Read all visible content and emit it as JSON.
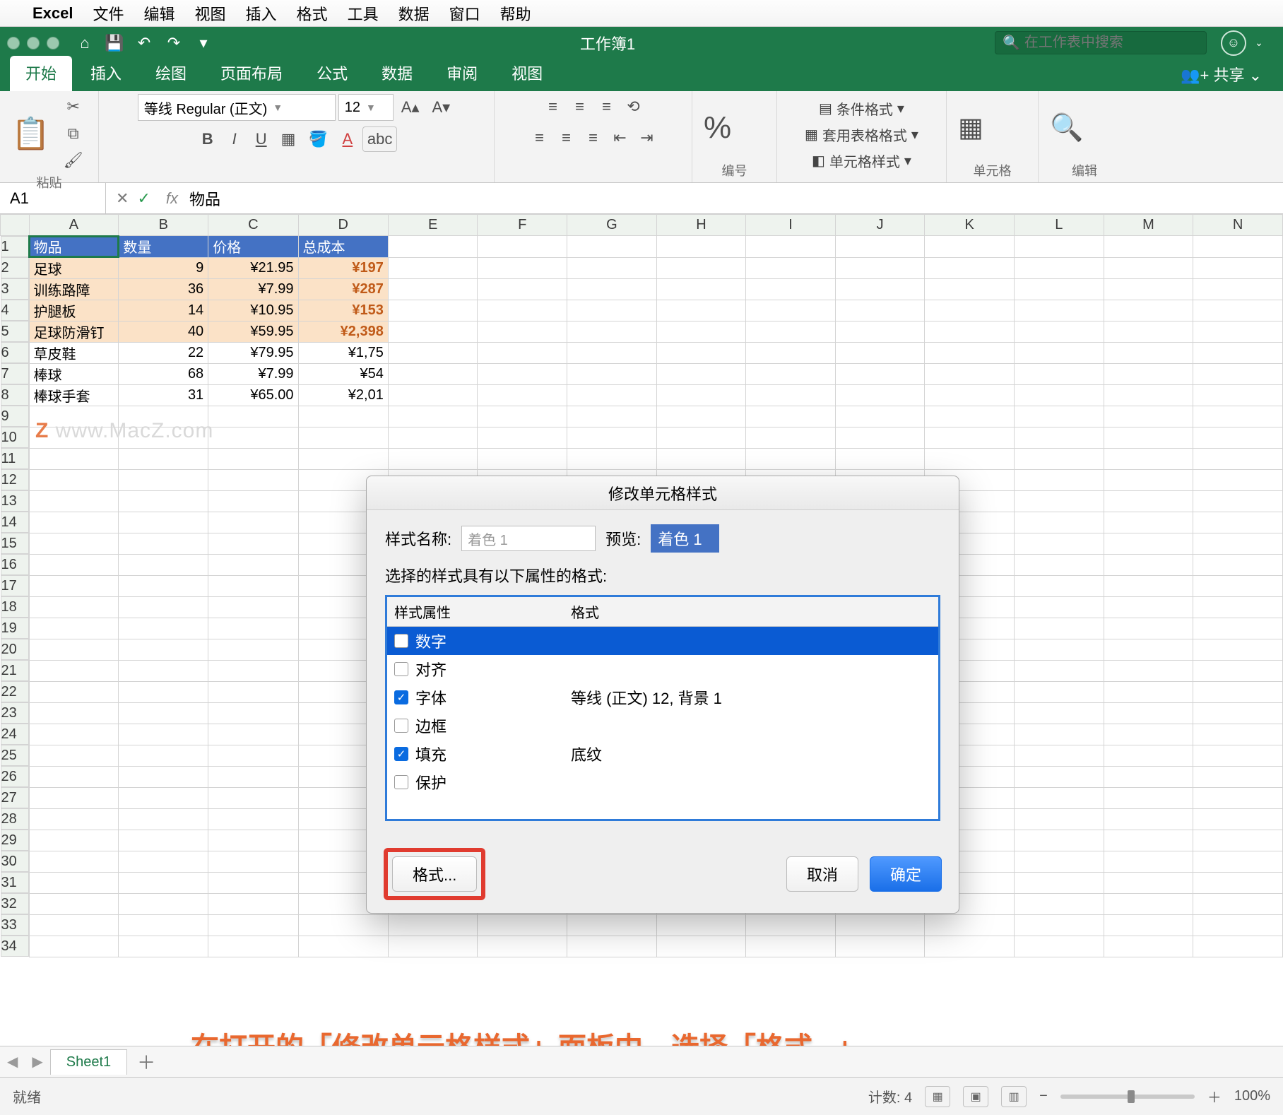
{
  "mac_menu": {
    "app": "Excel",
    "items": [
      "文件",
      "编辑",
      "视图",
      "插入",
      "格式",
      "工具",
      "数据",
      "窗口",
      "帮助"
    ]
  },
  "titlebar": {
    "doc": "工作簿1",
    "search_placeholder": "在工作表中搜索"
  },
  "tabs": {
    "items": [
      "开始",
      "插入",
      "绘图",
      "页面布局",
      "公式",
      "数据",
      "审阅",
      "视图"
    ],
    "active": 0,
    "share": "共享"
  },
  "ribbon": {
    "paste": "粘贴",
    "font_name": "等线 Regular (正文)",
    "font_size": "12",
    "number_group": "编号",
    "cond": [
      "条件格式",
      "套用表格格式",
      "单元格样式"
    ],
    "cells_group": "单元格",
    "edit_group": "编辑"
  },
  "formula": {
    "name": "A1",
    "value": "物品"
  },
  "columns": [
    "A",
    "B",
    "C",
    "D",
    "E",
    "F",
    "G",
    "H",
    "I",
    "J",
    "K",
    "L",
    "M",
    "N"
  ],
  "headers": [
    "物品",
    "数量",
    "价格",
    "总成本"
  ],
  "rows": [
    {
      "a": "足球",
      "b": "9",
      "c": "¥21.95",
      "d": "¥197",
      "hl": true
    },
    {
      "a": "训练路障",
      "b": "36",
      "c": "¥7.99",
      "d": "¥287",
      "hl": true
    },
    {
      "a": "护腿板",
      "b": "14",
      "c": "¥10.95",
      "d": "¥153",
      "hl": true
    },
    {
      "a": "足球防滑钉",
      "b": "40",
      "c": "¥59.95",
      "d": "¥2,398",
      "hl": true
    },
    {
      "a": "草皮鞋",
      "b": "22",
      "c": "¥79.95",
      "d": "¥1,75"
    },
    {
      "a": "棒球",
      "b": "68",
      "c": "¥7.99",
      "d": "¥54"
    },
    {
      "a": "棒球手套",
      "b": "31",
      "c": "¥65.00",
      "d": "¥2,01"
    }
  ],
  "watermark": {
    "z": "Z",
    "rest": "  www.MacZ.com"
  },
  "dialog": {
    "title": "修改单元格样式",
    "name_label": "样式名称:",
    "name_value": "着色 1",
    "preview_label": "预览:",
    "preview_value": "着色 1",
    "desc": "选择的样式具有以下属性的格式:",
    "col1": "样式属性",
    "col2": "格式",
    "items": [
      {
        "label": "数字",
        "checked": false,
        "sel": true,
        "val": ""
      },
      {
        "label": "对齐",
        "checked": false,
        "val": ""
      },
      {
        "label": "字体",
        "checked": true,
        "val": "等线 (正文) 12, 背景 1"
      },
      {
        "label": "边框",
        "checked": false,
        "val": ""
      },
      {
        "label": "填充",
        "checked": true,
        "val": "底纹"
      },
      {
        "label": "保护",
        "checked": false,
        "val": ""
      }
    ],
    "format_btn": "格式...",
    "cancel": "取消",
    "ok": "确定"
  },
  "caption": "在打开的「修改单元格样式」面板中，选择「格式...」",
  "sheettab": "Sheet1",
  "status": {
    "ready": "就绪",
    "count": "计数: 4",
    "zoom": "100%"
  }
}
